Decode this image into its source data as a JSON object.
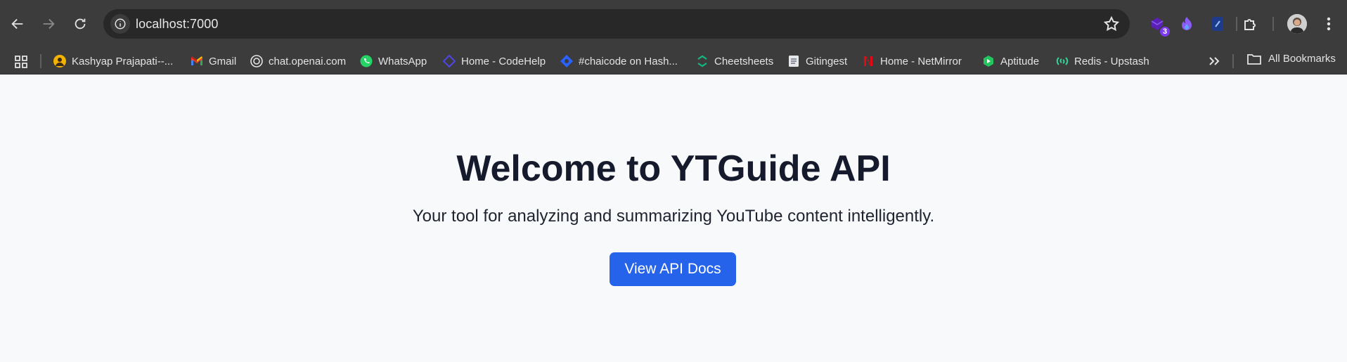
{
  "browser": {
    "url": "localhost:7000",
    "extension_badge": "3",
    "bookmarks": [
      {
        "label": "Kashyap Prajapati--...",
        "icon": "avatar-icon"
      },
      {
        "label": "Gmail",
        "icon": "gmail-icon"
      },
      {
        "label": "chat.openai.com",
        "icon": "openai-icon"
      },
      {
        "label": "WhatsApp",
        "icon": "whatsapp-icon"
      },
      {
        "label": "Home - CodeHelp",
        "icon": "codehelp-icon"
      },
      {
        "label": "#chaicode on Hash...",
        "icon": "hashnode-icon"
      },
      {
        "label": "Cheetsheets",
        "icon": "cheatsheets-icon"
      },
      {
        "label": "Gitingest",
        "icon": "gitingest-icon"
      },
      {
        "label": "Home - NetMirror",
        "icon": "netmirror-icon"
      },
      {
        "label": "Aptitude",
        "icon": "aptitude-icon"
      },
      {
        "label": "Redis - Upstash",
        "icon": "upstash-icon"
      }
    ],
    "all_bookmarks_label": "All Bookmarks"
  },
  "page": {
    "title": "Welcome to YTGuide API",
    "subtitle": "Your tool for analyzing and summarizing YouTube content intelligently.",
    "cta_label": "View API Docs",
    "accent_color": "#2563eb"
  }
}
